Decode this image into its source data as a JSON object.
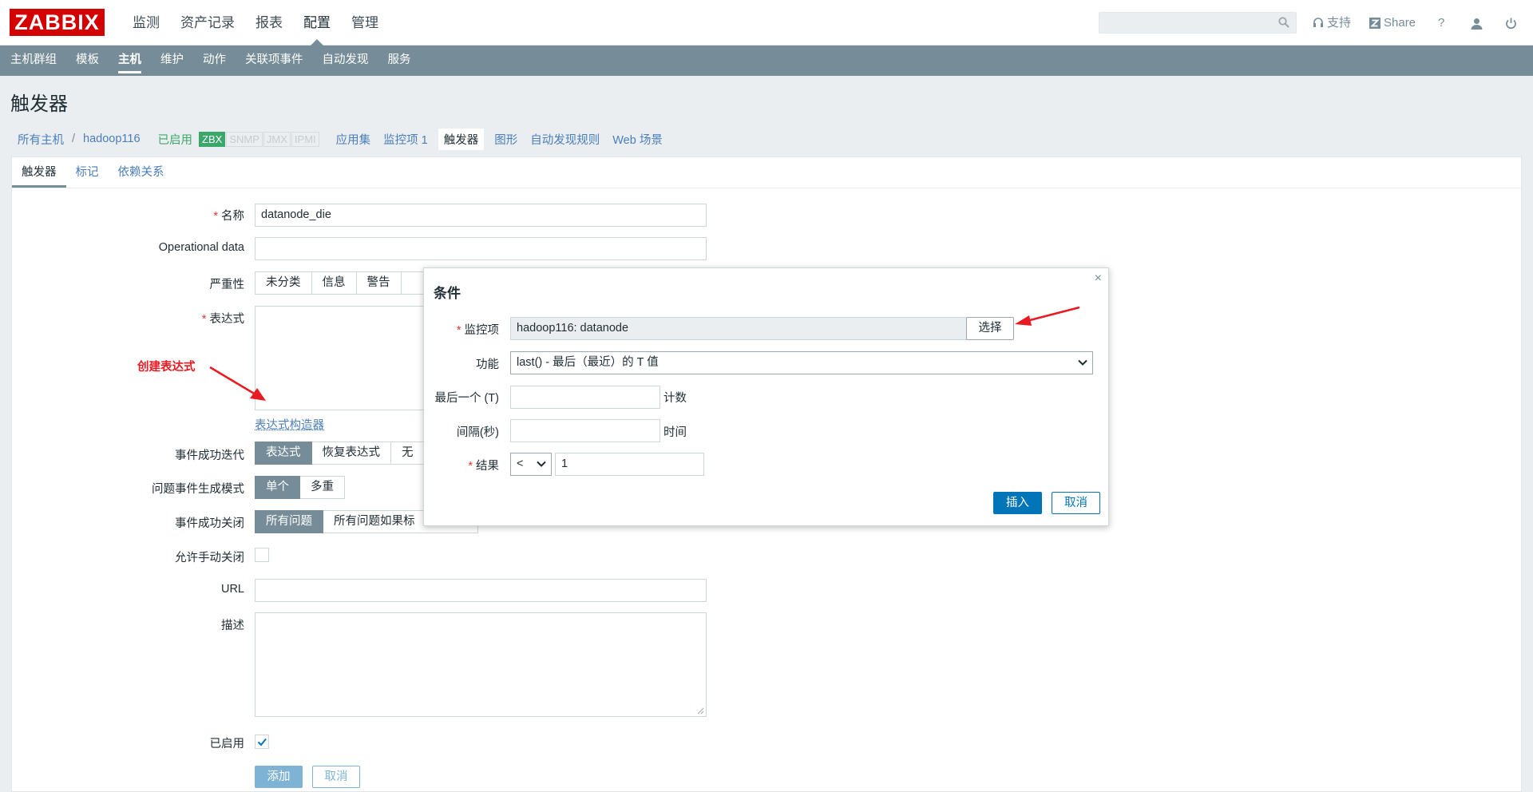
{
  "logo": "ZABBIX",
  "main_nav": [
    "监测",
    "资产记录",
    "报表",
    "配置",
    "管理"
  ],
  "main_nav_active": 3,
  "header_tools": {
    "support": "支持",
    "share": "Share",
    "help": "?"
  },
  "sub_nav": [
    "主机群组",
    "模板",
    "主机",
    "维护",
    "动作",
    "关联项事件",
    "自动发现",
    "服务"
  ],
  "sub_nav_active": 2,
  "page_title": "触发器",
  "host_nav": {
    "all_hosts": "所有主机",
    "separator": "/",
    "host": "hadoop116",
    "status": "已启用",
    "badges": [
      "ZBX",
      "SNMP",
      "JMX",
      "IPMI"
    ],
    "links": [
      "应用集",
      "监控项 1",
      "触发器",
      "图形",
      "自动发现规则",
      "Web 场景"
    ],
    "active_link": 2
  },
  "form_tabs": [
    "触发器",
    "标记",
    "依赖关系"
  ],
  "form": {
    "name_label": "名称",
    "name_value": "datanode_die",
    "opdata_label": "Operational data",
    "opdata_value": "",
    "severity_label": "严重性",
    "severity_options": [
      "未分类",
      "信息",
      "警告"
    ],
    "expression_label": "表达式",
    "expression_builder": "表达式构造器",
    "annotation": "创建表达式",
    "recovery_label": "事件成功迭代",
    "recovery_options": [
      "表达式",
      "恢复表达式",
      "无"
    ],
    "problem_mode_label": "问题事件生成模式",
    "problem_mode_options": [
      "单个",
      "多重"
    ],
    "ok_close_label": "事件成功关闭",
    "ok_close_options": [
      "所有问题",
      "所有问题如果标"
    ],
    "manual_close_label": "允许手动关闭",
    "url_label": "URL",
    "url_value": "",
    "desc_label": "描述",
    "enabled_label": "已启用",
    "add_button": "添加",
    "cancel_button": "取消"
  },
  "dialog": {
    "title": "条件",
    "close": "×",
    "item_label": "监控项",
    "item_value": "hadoop116: datanode",
    "select_button": "选择",
    "function_label": "功能",
    "function_value": "last() - 最后（最近）的 T 值",
    "last_label": "最后一个 (T)",
    "last_unit": "计数",
    "interval_label": "间隔(秒)",
    "interval_unit": "时间",
    "result_label": "结果",
    "result_operator": "<",
    "result_value": "1",
    "insert_button": "插入",
    "cancel_button": "取消"
  },
  "colors": {
    "accent": "#768d99",
    "primary": "#0275b8",
    "logo": "#d40000",
    "annotation": "#e81b23"
  }
}
